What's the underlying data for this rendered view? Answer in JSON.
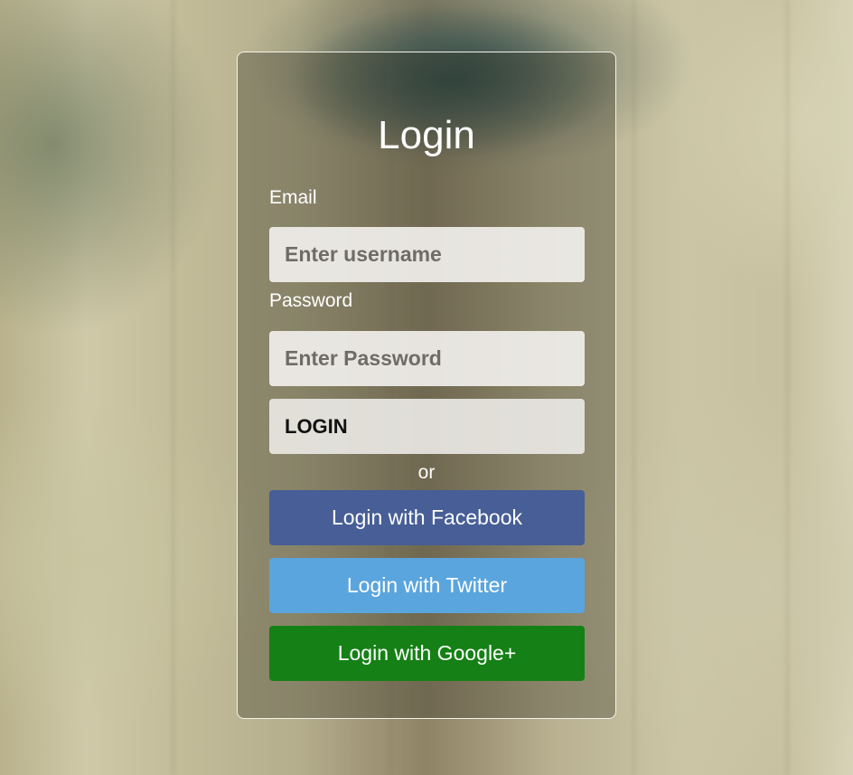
{
  "form": {
    "title": "Login",
    "email_label": "Email",
    "email_placeholder": "Enter username",
    "email_value": "",
    "password_label": "Password",
    "password_placeholder": "Enter Password",
    "password_value": "",
    "login_label": "LOGIN",
    "or_text": "or"
  },
  "social": {
    "facebook_label": "Login with Facebook",
    "twitter_label": "Login with Twitter",
    "google_label": "Login with Google+"
  },
  "colors": {
    "facebook": "#475e96",
    "twitter": "#5aa5dd",
    "google": "#158015"
  }
}
